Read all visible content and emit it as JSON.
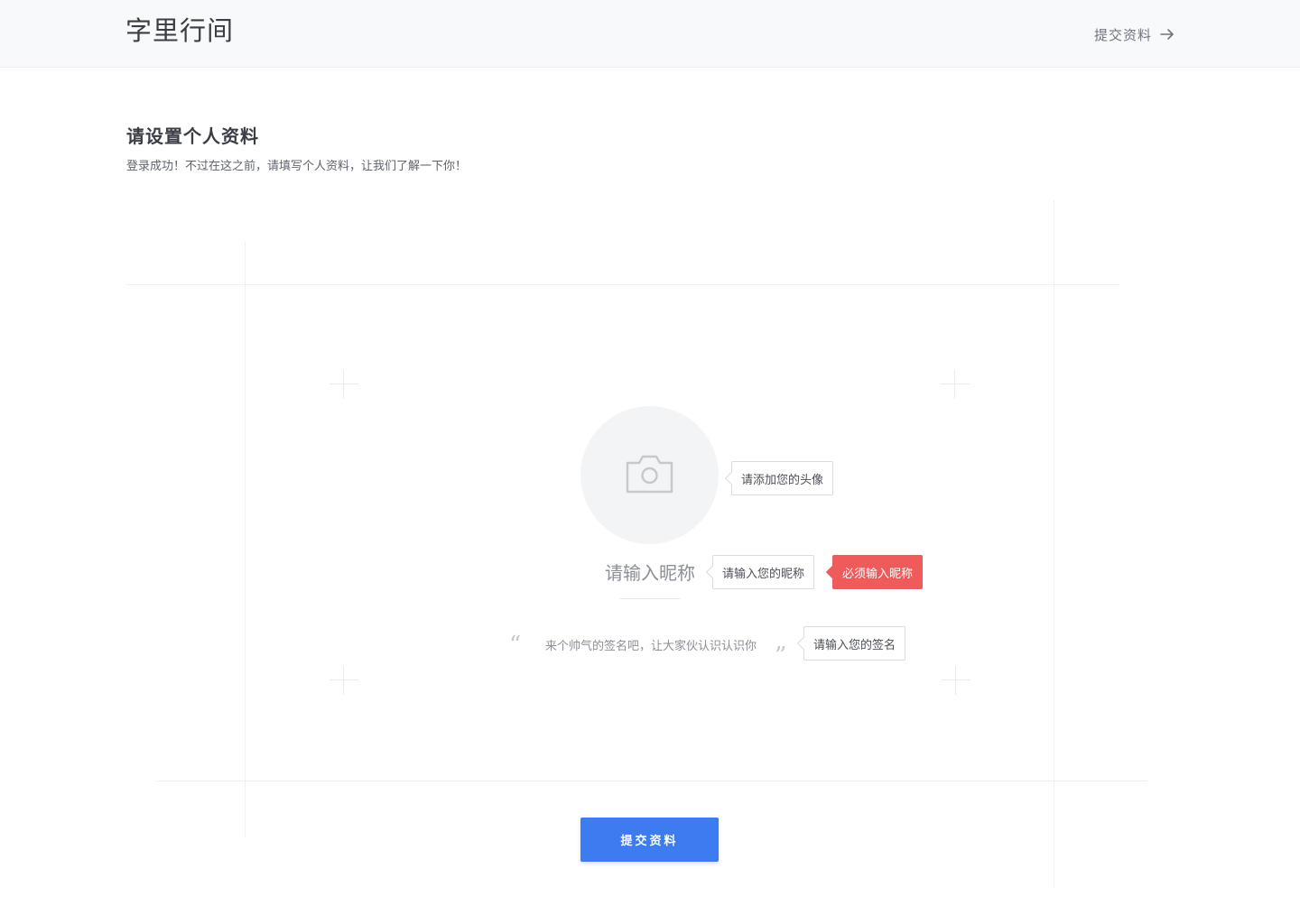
{
  "header": {
    "logo_text": "字里行间",
    "submit_link_label": "提交资料",
    "submit_link_icon": "arrow-right-icon"
  },
  "intro": {
    "title": "请设置个人资料",
    "subtitle": "登录成功！不过在这之前，请填写个人资料，让我们了解一下你！"
  },
  "form": {
    "avatar": {
      "icon": "camera-icon",
      "tooltip": "请添加您的头像"
    },
    "nickname": {
      "placeholder": "请输入昵称",
      "value": "",
      "tooltip": "请输入您的昵称",
      "error": "必须输入昵称"
    },
    "signature": {
      "placeholder": "来个帅气的签名吧，让大家伙认识认识你",
      "value": "",
      "open_quote": "“",
      "close_quote": "”",
      "tooltip": "请输入您的签名"
    },
    "submit_label": "提交资料"
  },
  "colors": {
    "accent": "#3c7bf0",
    "error": "#ef5b5b",
    "header_bg": "#f8f9fa",
    "avatar_bg": "#f3f4f6"
  }
}
